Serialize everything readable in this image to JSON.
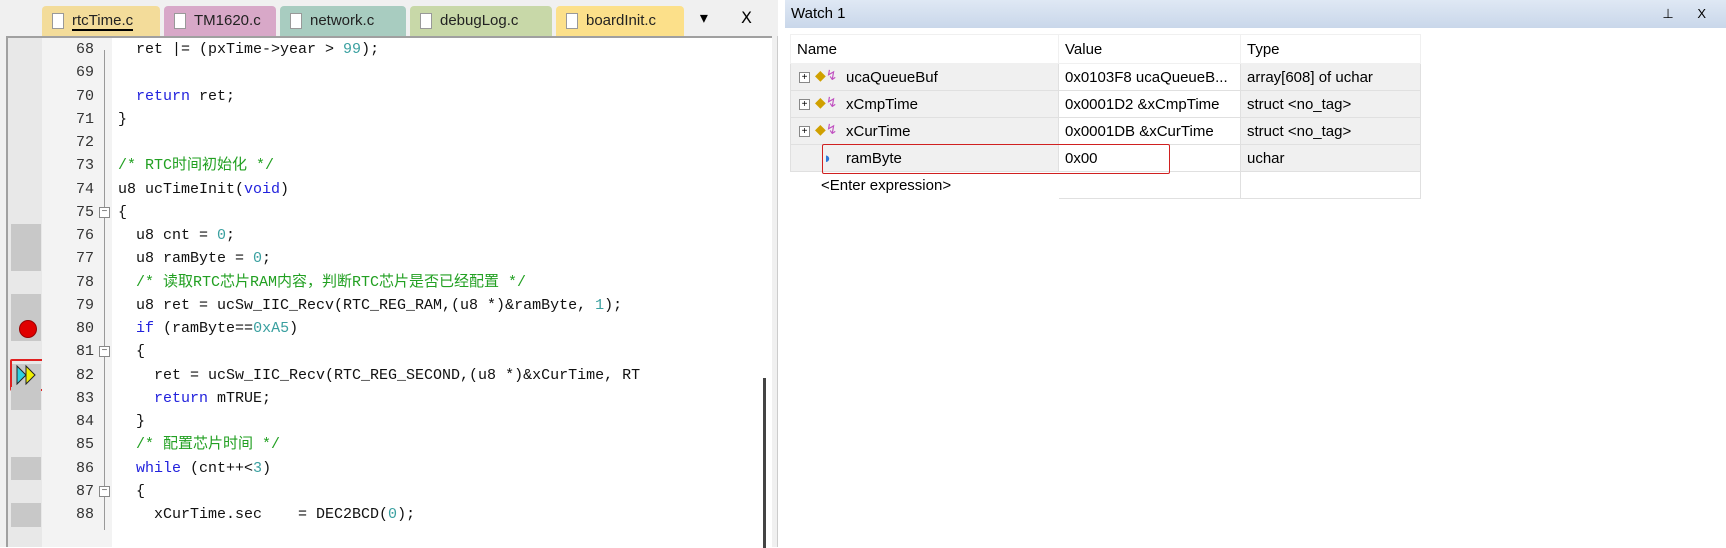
{
  "editor": {
    "tabs": [
      {
        "label": "rtcTime.c",
        "color": "#f3dc9a",
        "active": true
      },
      {
        "label": "TM1620.c",
        "color": "#d8a8c8"
      },
      {
        "label": "network.c",
        "color": "#a8ccc0"
      },
      {
        "label": "debugLog.c",
        "color": "#c8d8a8"
      },
      {
        "label": "boardInit.c",
        "color": "#fce08a"
      }
    ],
    "tab_controls": "▾ X",
    "lines": [
      {
        "n": "68",
        "seg": [
          [
            "",
            "  ret |= (pxTime->year > "
          ],
          [
            "num",
            "99"
          ],
          [
            "",
            ");"
          ]
        ]
      },
      {
        "n": "69",
        "seg": []
      },
      {
        "n": "70",
        "seg": [
          [
            "",
            "  "
          ],
          [
            "kw",
            "return"
          ],
          [
            "",
            " ret;"
          ]
        ]
      },
      {
        "n": "71",
        "seg": [
          [
            "",
            "}"
          ]
        ]
      },
      {
        "n": "72",
        "seg": []
      },
      {
        "n": "73",
        "seg": [
          [
            "cm",
            "/* RTC时间初始化 */"
          ]
        ]
      },
      {
        "n": "74",
        "seg": [
          [
            "",
            "u8 ucTimeInit("
          ],
          [
            "kw",
            "void"
          ],
          [
            "",
            ")"
          ]
        ]
      },
      {
        "n": "75",
        "seg": [
          [
            "",
            "{"
          ]
        ],
        "fold": true
      },
      {
        "n": "76",
        "seg": [
          [
            "",
            "  u8 cnt = "
          ],
          [
            "num",
            "0"
          ],
          [
            "",
            ";"
          ]
        ],
        "gray": true
      },
      {
        "n": "77",
        "seg": [
          [
            "",
            "  u8 ramByte = "
          ],
          [
            "num",
            "0"
          ],
          [
            "",
            ";"
          ]
        ],
        "gray": true
      },
      {
        "n": "78",
        "seg": [
          [
            "cm",
            "  /* 读取RTC芯片RAM内容，判断RTC芯片是否已经配置 */"
          ]
        ]
      },
      {
        "n": "79",
        "seg": [
          [
            "",
            "  u8 ret = ucSw_IIC_Recv(RTC_REG_RAM,(u8 *)&ramByte, "
          ],
          [
            "num",
            "1"
          ],
          [
            "",
            ");"
          ]
        ],
        "gray": true
      },
      {
        "n": "80",
        "seg": [
          [
            "",
            "  "
          ],
          [
            "kw",
            "if"
          ],
          [
            "",
            " (ramByte=="
          ],
          [
            "num",
            "0xA5"
          ],
          [
            "",
            ")"
          ]
        ],
        "gray": true,
        "breakpoint": true
      },
      {
        "n": "81",
        "seg": [
          [
            "",
            "  {"
          ]
        ],
        "fold": true
      },
      {
        "n": "82",
        "seg": [
          [
            "",
            "    ret = ucSw_IIC_Recv(RTC_REG_SECOND,(u8 *)&xCurTime, RT"
          ]
        ],
        "gray": true,
        "current": true
      },
      {
        "n": "83",
        "seg": [
          [
            "",
            "    "
          ],
          [
            "kw",
            "return"
          ],
          [
            "",
            " mTRUE;"
          ]
        ],
        "gray": true
      },
      {
        "n": "84",
        "seg": [
          [
            "",
            "  }"
          ]
        ]
      },
      {
        "n": "85",
        "seg": [
          [
            "cm",
            "  /* 配置芯片时间 */"
          ]
        ]
      },
      {
        "n": "86",
        "seg": [
          [
            "",
            "  "
          ],
          [
            "kw",
            "while"
          ],
          [
            "",
            " (cnt++<"
          ],
          [
            "num",
            "3"
          ],
          [
            "",
            ")"
          ]
        ],
        "gray": true
      },
      {
        "n": "87",
        "seg": [
          [
            "",
            "  {"
          ]
        ],
        "fold": true
      },
      {
        "n": "88",
        "seg": [
          [
            "",
            "    xCurTime.sec    = DEC2BCD("
          ],
          [
            "num",
            "0"
          ],
          [
            "",
            ");"
          ]
        ],
        "gray": true
      }
    ]
  },
  "watch": {
    "title": "Watch 1",
    "controls": "⊥ X",
    "headers": {
      "name": "Name",
      "value": "Value",
      "type": "Type"
    },
    "rows": [
      {
        "name": "ucaQueueBuf",
        "value": "0x0103F8 ucaQueueB...",
        "type": "array[608] of uchar",
        "expandable": true
      },
      {
        "name": "xCmpTime",
        "value": "0x0001D2 &xCmpTime",
        "type": "struct <no_tag>",
        "expandable": true
      },
      {
        "name": "xCurTime",
        "value": "0x0001DB &xCurTime",
        "type": "struct <no_tag>",
        "expandable": true
      },
      {
        "name": "ramByte",
        "value": "0x00",
        "type": "uchar",
        "expandable": false,
        "highlighted": true
      }
    ],
    "enter_expression": "<Enter expression>"
  }
}
